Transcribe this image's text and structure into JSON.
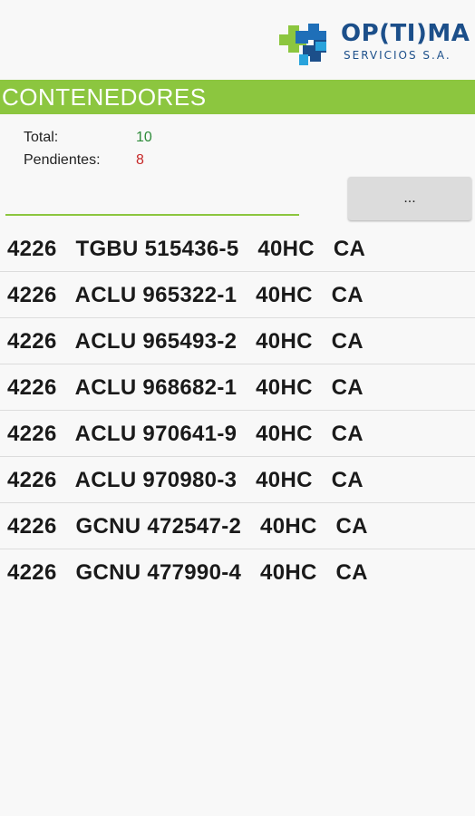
{
  "logo": {
    "title": "OP(TI)MA",
    "subtitle": "SERVICIOS S.A."
  },
  "title_bar": {
    "label": "CONTENEDORES"
  },
  "stats": {
    "total_label": "Total:",
    "total_value": "10",
    "pending_label": "Pendientes:",
    "pending_value": "8"
  },
  "scan": {
    "value": ""
  },
  "more_button": {
    "label": "..."
  },
  "containers": [
    "4226   TGBU 515436-5   40HC   CA",
    "4226   ACLU 965322-1   40HC   CA",
    "4226   ACLU 965493-2   40HC   CA",
    "4226   ACLU 968682-1   40HC   CA",
    "4226   ACLU 970641-9   40HC   CA",
    "4226   ACLU 970980-3   40HC   CA",
    "4226   GCNU 472547-2   40HC   CA",
    "4226   GCNU 477990-4   40HC   CA"
  ],
  "colors": {
    "accent_green": "#8cc63f",
    "brand_blue": "#1c4f8a",
    "total_green": "#2e8b3a",
    "pending_red": "#c62828"
  }
}
